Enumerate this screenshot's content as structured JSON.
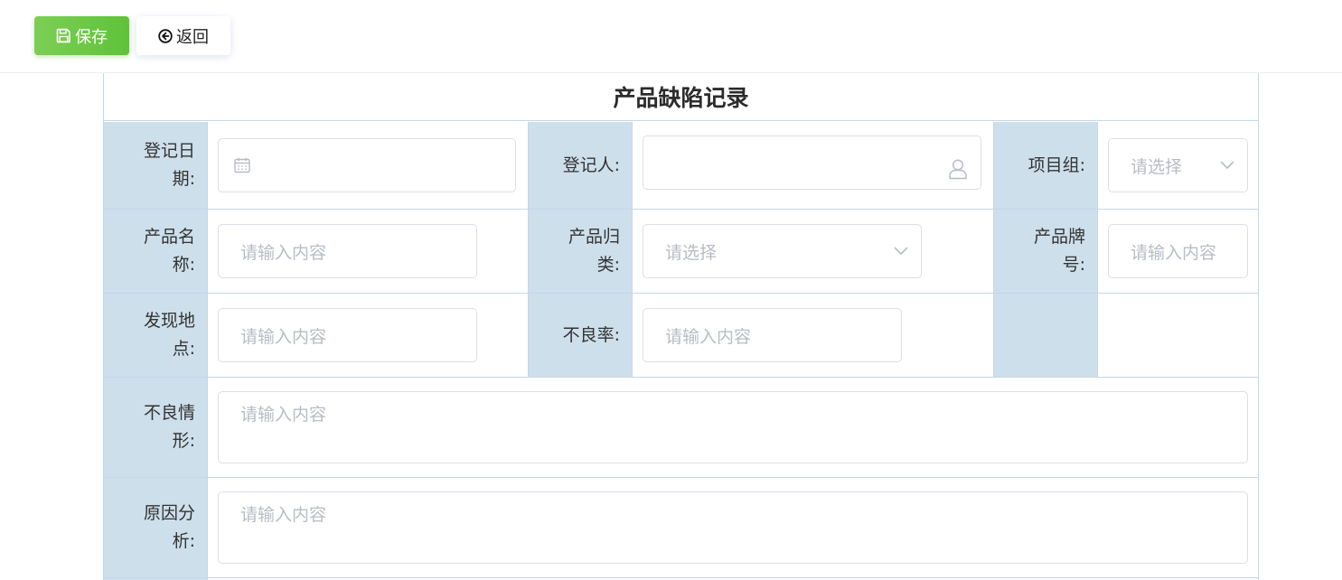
{
  "toolbar": {
    "save_label": "保存",
    "back_label": "返回",
    "save_color": "#67c23a"
  },
  "form": {
    "title": "产品缺陷记录",
    "fields": {
      "register_date": {
        "label": "登记日期:",
        "value": ""
      },
      "registrant": {
        "label": "登记人:",
        "value": ""
      },
      "project_group": {
        "label": "项目组:",
        "placeholder": "请选择"
      },
      "product_name": {
        "label": "产品名称:",
        "placeholder": "请输入内容"
      },
      "product_category": {
        "label": "产品归类:",
        "placeholder": "请选择"
      },
      "product_brand": {
        "label": "产品牌号:",
        "placeholder": "请输入内容"
      },
      "discovery_location": {
        "label": "发现地点:",
        "placeholder": "请输入内容"
      },
      "defect_rate": {
        "label": "不良率:",
        "placeholder": "请输入内容"
      },
      "defect_situation": {
        "label": "不良情形:",
        "placeholder": "请输入内容"
      },
      "cause_analysis": {
        "label": "原因分析:",
        "placeholder": "请输入内容"
      }
    }
  },
  "colors": {
    "label_bg": "#cddfeb",
    "border": "#c5d7e6",
    "placeholder": "#b8bcc4"
  },
  "icons": {
    "save": "save-icon",
    "back": "back-circle-icon",
    "date": "calendar-icon",
    "user": "user-icon",
    "select": "chevron-down-icon"
  }
}
